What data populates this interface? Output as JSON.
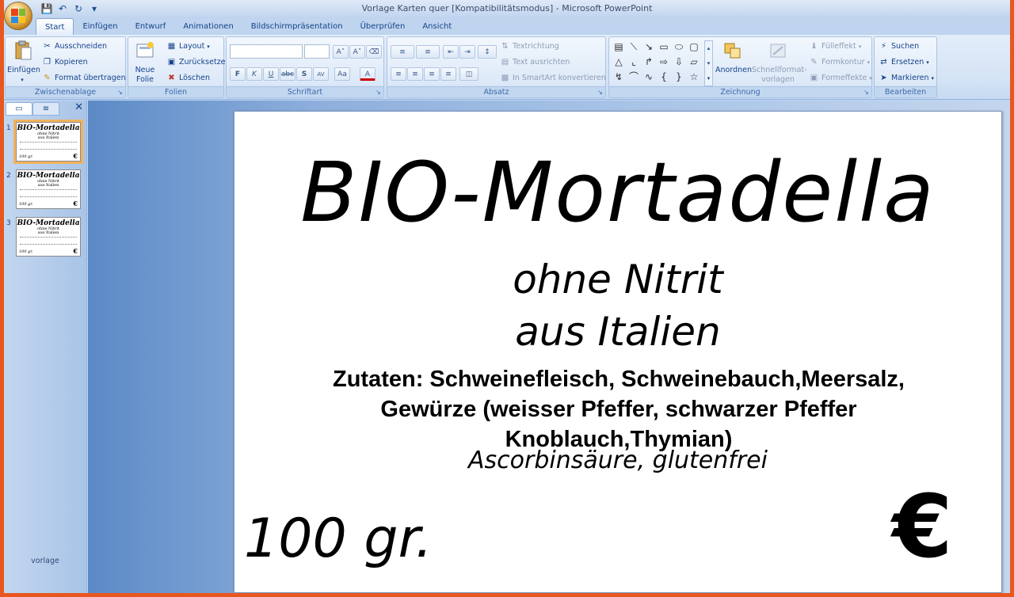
{
  "window": {
    "title": "Vorlage Karten quer [Kompatibilitätsmodus] - Microsoft PowerPoint"
  },
  "tabs": [
    "Start",
    "Einfügen",
    "Entwurf",
    "Animationen",
    "Bildschirmpräsentation",
    "Überprüfen",
    "Ansicht"
  ],
  "ribbon": {
    "clipboard": {
      "label": "Zwischenablage",
      "paste": "Einfügen",
      "cut": "Ausschneiden",
      "copy": "Kopieren",
      "format_painter": "Format übertragen"
    },
    "slides": {
      "label": "Folien",
      "new_slide_line1": "Neue",
      "new_slide_line2": "Folie",
      "layout": "Layout",
      "reset": "Zurücksetzen",
      "delete": "Löschen"
    },
    "font": {
      "label": "Schriftart"
    },
    "paragraph": {
      "label": "Absatz",
      "text_direction": "Textrichtung",
      "align_text": "Text ausrichten",
      "smartart": "In SmartArt konvertieren"
    },
    "drawing": {
      "label": "Zeichnung",
      "arrange": "Anordnen",
      "quick_styles_line1": "Schnellformat-",
      "quick_styles_line2": "vorlagen",
      "fill": "Fülleffekt",
      "outline": "Formkontur",
      "effects": "Formeffekte"
    },
    "editing": {
      "label": "Bearbeiten",
      "find": "Suchen",
      "replace": "Ersetzen",
      "select": "Markieren"
    }
  },
  "slides_panel": {
    "thumbnails": [
      {
        "num": "1",
        "title": "BIO-Mortadella",
        "sub1": "ohne Nitrit",
        "sub2": "aus Italien",
        "weight": "100 gr.",
        "euro": "€"
      },
      {
        "num": "2",
        "title": "BIO-Mortadella",
        "sub1": "ohne Nitrit",
        "sub2": "aus Italien",
        "weight": "100 gr.",
        "euro": "€"
      },
      {
        "num": "3",
        "title": "BIO-Mortadella",
        "sub1": "ohne Nitrit",
        "sub2": "aus Italien",
        "weight": "100 gr.",
        "euro": "€"
      }
    ],
    "footer": "vorlage"
  },
  "slide": {
    "title": "BIO-Mortadella",
    "subtitle1": "ohne Nitrit",
    "subtitle2": "aus Italien",
    "ingredients_line1": "Zutaten: Schweinefleisch, Schweinebauch,Meersalz,",
    "ingredients_line2": "Gewürze (weisser Pfeffer, schwarzer Pfeffer",
    "ingredients_line3": "Knoblauch,Thymian)",
    "extra": "Ascorbinsäure, glutenfrei",
    "weight": "100 gr.",
    "currency": "€"
  }
}
